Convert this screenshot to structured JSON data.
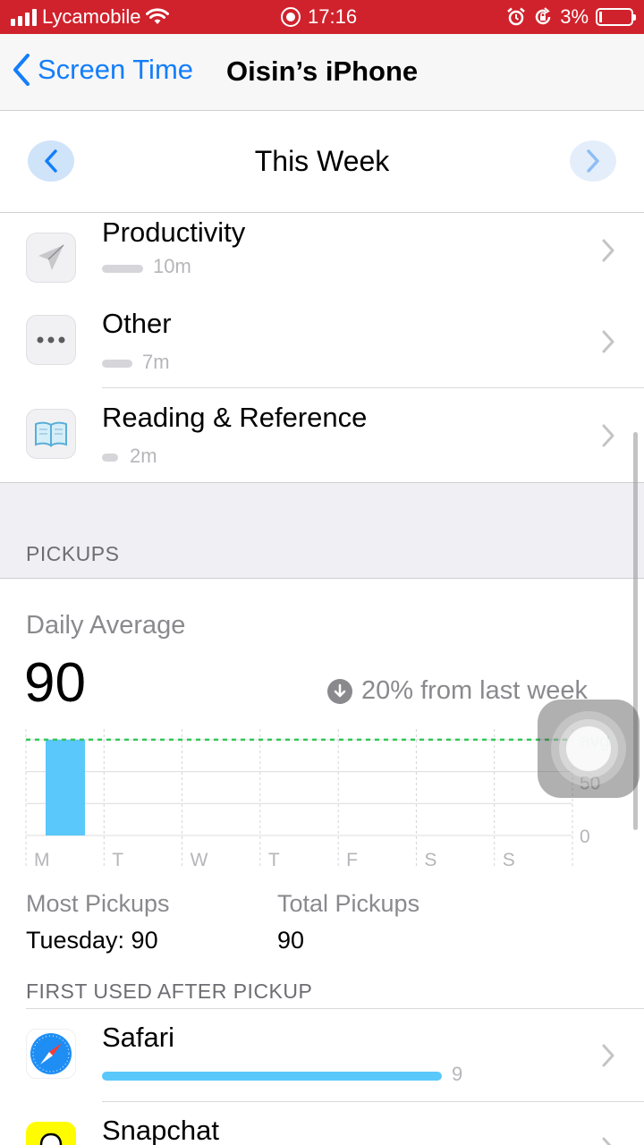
{
  "status_bar": {
    "carrier": "Lycamobile",
    "time": "17:16",
    "battery": "3%",
    "color": "#d0222c"
  },
  "nav": {
    "back_label": "Screen Time",
    "title": "Oisin’s iPhone"
  },
  "week": {
    "title": "This Week"
  },
  "categories": [
    {
      "name": "Productivity",
      "time": "10m",
      "icon": "paper-plane-icon"
    },
    {
      "name": "Other",
      "time": "7m",
      "icon": "ellipsis-icon"
    },
    {
      "name": "Reading & Reference",
      "time": "2m",
      "icon": "book-icon"
    }
  ],
  "pickups": {
    "section_label": "PICKUPS",
    "daily_average_label": "Daily Average",
    "daily_average_value": "90",
    "change_text": "20% from last week",
    "most_pickups_label": "Most Pickups",
    "most_pickups_value": "Tuesday: 90",
    "total_pickups_label": "Total Pickups",
    "total_pickups_value": "90"
  },
  "chart_data": {
    "type": "bar",
    "categories": [
      "M",
      "T",
      "W",
      "T",
      "F",
      "S",
      "S"
    ],
    "values": [
      90,
      0,
      0,
      0,
      0,
      0,
      0
    ],
    "average": 90,
    "y_ticks": [
      "avg",
      "50",
      "0"
    ],
    "ylim": [
      0,
      100
    ],
    "bar_color": "#5ac8fa",
    "average_line_color": "#34c759"
  },
  "first_used": {
    "section_label": "FIRST USED AFTER PICKUP",
    "apps": [
      {
        "name": "Safari",
        "count": "9",
        "icon": "safari-icon"
      },
      {
        "name": "Snapchat",
        "count": "",
        "icon": "snapchat-icon"
      }
    ]
  }
}
